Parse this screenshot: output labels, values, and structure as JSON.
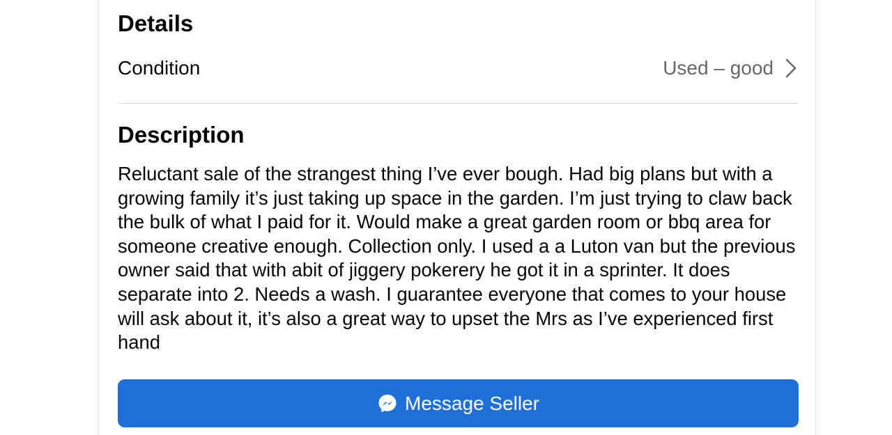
{
  "details": {
    "heading": "Details",
    "condition_label": "Condition",
    "condition_value": "Used – good"
  },
  "description": {
    "heading": "Description",
    "text": "Reluctant sale of the strangest thing I’ve ever bough. Had big plans but with a growing family it’s just taking up space in the garden. I’m just trying to claw back the bulk of what I paid for it. Would make a great garden room or bbq area for someone creative enough. Collection only. I used a a Luton van but the previous owner said that with abit of jiggery pokerery he got it in a sprinter. It does separate into 2. Needs a wash. I guarantee everyone that comes to your house will ask about it, it’s also a great way to upset the Mrs as I’ve experienced first hand"
  },
  "actions": {
    "message_label": "Message Seller",
    "message_icon": "messenger-icon",
    "button_color": "#1f6fd8"
  },
  "icons": {
    "condition_chevron": "chevron-right-icon"
  }
}
